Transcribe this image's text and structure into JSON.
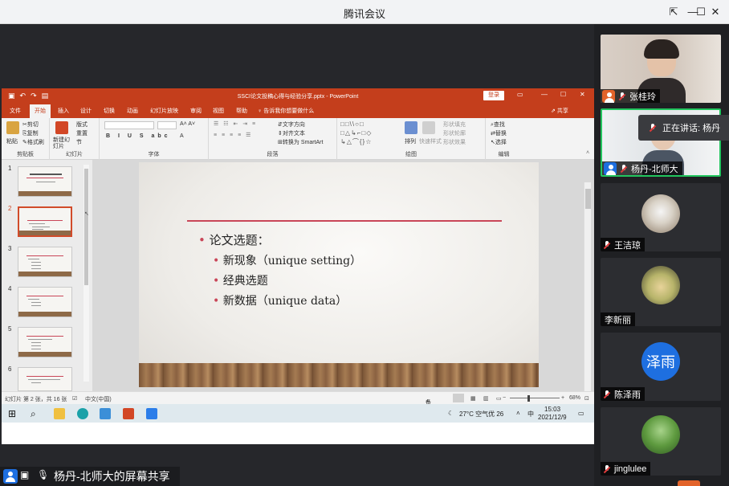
{
  "meeting": {
    "title": "腾讯会议",
    "sharer_label": "杨丹-北师大的屏幕共享"
  },
  "window_controls": {
    "pin": "⇱",
    "minimize": "—",
    "maximize": "☐",
    "close": "✕"
  },
  "ppt": {
    "document_title": "SSCI论文投稿心得与经验分享.pptx - PowerPoint",
    "login_label": "登录",
    "share_label": "共享",
    "tabs": [
      "文件",
      "开始",
      "插入",
      "设计",
      "切换",
      "动画",
      "幻灯片放映",
      "审阅",
      "视图",
      "帮助"
    ],
    "tell_me": "告诉我你想要做什么",
    "ribbon": {
      "clipboard": {
        "paste": "粘贴",
        "cut": "剪切",
        "copy": "复制",
        "format_painter": "格式刷",
        "label": "剪贴板"
      },
      "slides": {
        "new_slide": "新建幻灯片",
        "layout": "版式",
        "reset": "重置",
        "section": "节",
        "label": "幻灯片"
      },
      "font": {
        "label": "字体"
      },
      "paragraph": {
        "text_direction": "文字方向",
        "align_text": "对齐文本",
        "smartart": "转换为 SmartArt",
        "label": "段落"
      },
      "drawing": {
        "arrange": "排列",
        "quick_styles": "快速样式",
        "fill": "形状填充",
        "outline": "形状轮廓",
        "effects": "形状效果",
        "label": "绘图"
      },
      "editing": {
        "find": "查找",
        "replace": "替换",
        "select": "选择",
        "label": "编辑"
      }
    },
    "thumbnails": [
      "1",
      "2",
      "3",
      "4",
      "5",
      "6"
    ],
    "active_slide_index": 2,
    "slide": {
      "bullet": "•",
      "heading": "论文选题：",
      "items": [
        "新现象（unique setting）",
        "经典选题",
        "新数据（unique data）"
      ]
    },
    "status": {
      "slide_info": "幻灯片 第 2 张，共 16 张",
      "language": "中文(中国)",
      "notes": "备注",
      "zoom": "68%"
    }
  },
  "taskbar": {
    "weather": "27°C 空气优 26",
    "ime": "中",
    "time": "15:03",
    "date": "2021/12/9"
  },
  "participants": [
    {
      "name": "张桂玲"
    },
    {
      "name": "杨丹-北师大"
    },
    {
      "name": "王洁琼"
    },
    {
      "name": "李新丽"
    },
    {
      "name": "陈泽雨",
      "badge": "泽雨"
    },
    {
      "name": "jinglulee"
    }
  ],
  "speaking_tip": "正在讲话: 杨丹"
}
